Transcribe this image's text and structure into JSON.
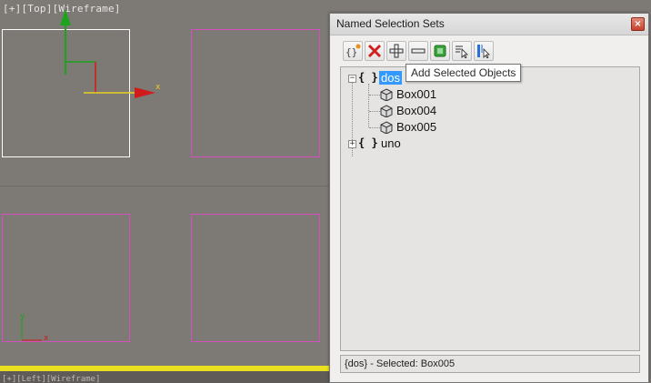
{
  "viewport": {
    "label": "[+][Top][Wireframe]",
    "axis_x_label": "x",
    "mini_axis_x": "x",
    "mini_axis_y": "y",
    "bottom_bar_text": "[+][Left][Wireframe]"
  },
  "dialog": {
    "title": "Named Selection Sets",
    "close_glyph": "×",
    "tooltip": "Add Selected Objects",
    "tree": [
      {
        "name": "dos",
        "selected": true,
        "expanded": true,
        "children": [
          "Box001",
          "Box004",
          "Box005"
        ]
      },
      {
        "name": "uno",
        "selected": false,
        "expanded": false,
        "children": []
      }
    ],
    "set_icon_glyph": "{ }",
    "expand_minus": "−",
    "expand_plus": "+",
    "status": "{dos} - Selected: Box005"
  },
  "toolbar": [
    {
      "name": "create-new-set-button",
      "icon": "new-set-icon"
    },
    {
      "name": "remove-button",
      "icon": "red-x-icon"
    },
    {
      "name": "add-selected-objects-button",
      "icon": "plus-icon"
    },
    {
      "name": "subtract-selected-objects-button",
      "icon": "minus-icon"
    },
    {
      "name": "select-objects-in-set-button",
      "icon": "select-set-icon"
    },
    {
      "name": "select-objects-by-name-button",
      "icon": "select-by-name-icon"
    },
    {
      "name": "highlight-selected-objects-button",
      "icon": "highlight-icon"
    }
  ],
  "colors": {
    "viewport_bg": "#7d7975",
    "box_outline": "#d64fbf",
    "selected_box": "#ffffff",
    "axis_x": "#d11a1a",
    "axis_y": "#1da31d",
    "selection_highlight": "#3399ff"
  }
}
